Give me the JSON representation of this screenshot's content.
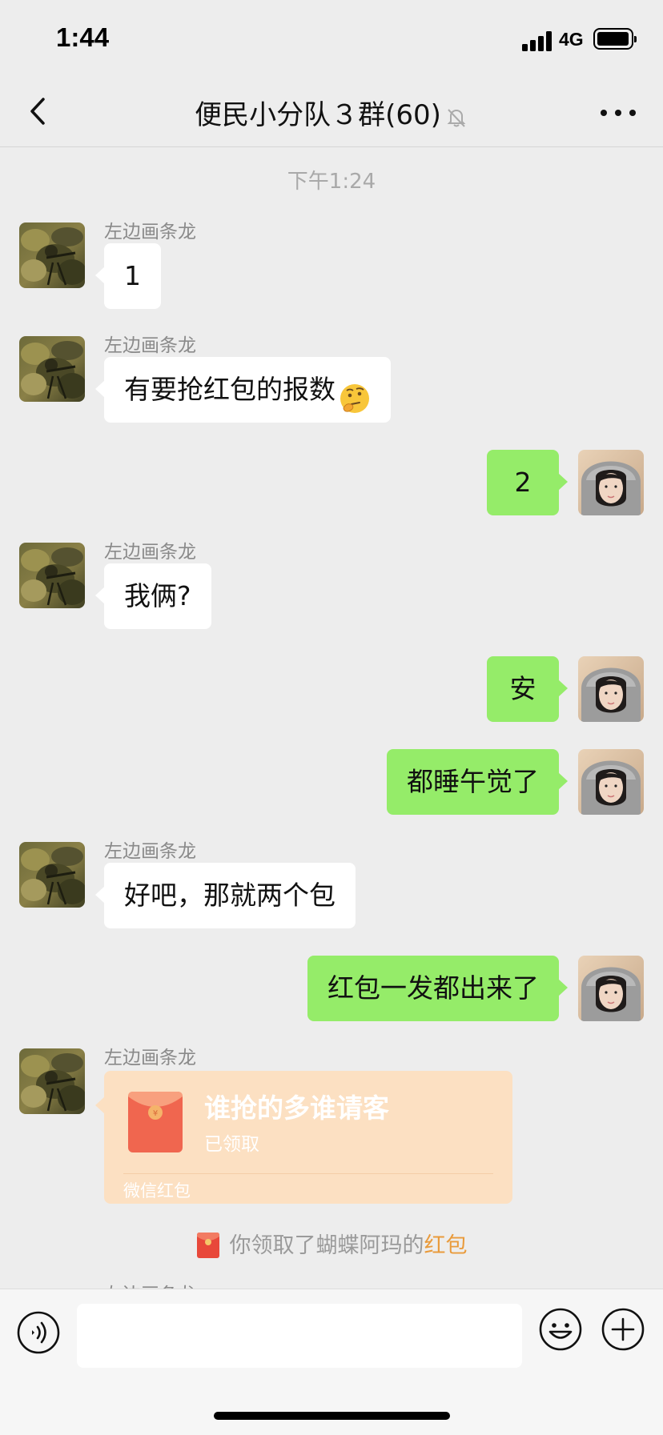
{
  "status_bar": {
    "time": "1:44",
    "network": "4G"
  },
  "header": {
    "title": "便民小分队３群(60)",
    "back_icon": "chevron-left-icon",
    "muted_icon": "bell-muted-icon",
    "more_icon": "more-dots-icon"
  },
  "chat": {
    "timestamp": "下午1:24",
    "messages": [
      {
        "side": "in",
        "sender": "左边画条龙",
        "text": "1"
      },
      {
        "side": "in",
        "sender": "左边画条龙",
        "text": "有要抢红包的报数",
        "emoji": "thinking-face"
      },
      {
        "side": "out",
        "text": "2"
      },
      {
        "side": "in",
        "sender": "左边画条龙",
        "text": "我俩?"
      },
      {
        "side": "out",
        "text": "安"
      },
      {
        "side": "out",
        "text": "都睡午觉了"
      },
      {
        "side": "in",
        "sender": "左边画条龙",
        "text": "好吧，那就两个包"
      },
      {
        "side": "out",
        "text": "红包一发都出来了"
      }
    ],
    "red_packet": {
      "sender": "左边画条龙",
      "title": "谁抢的多谁请客",
      "status": "已领取",
      "brand": "微信红包"
    },
    "system_notice": {
      "prefix": "你领取了蝴蝶阿玛的",
      "link": "红包"
    },
    "partial_sender": "左边画条龙"
  },
  "input_bar": {
    "voice_icon": "voice-icon",
    "emoji_icon": "emoji-icon",
    "plus_icon": "plus-icon",
    "value": ""
  },
  "colors": {
    "background": "#ededed",
    "outgoing_bubble": "#95ec69",
    "incoming_bubble": "#ffffff",
    "red_packet": "#fce0c2",
    "link": "#e99b3c"
  }
}
